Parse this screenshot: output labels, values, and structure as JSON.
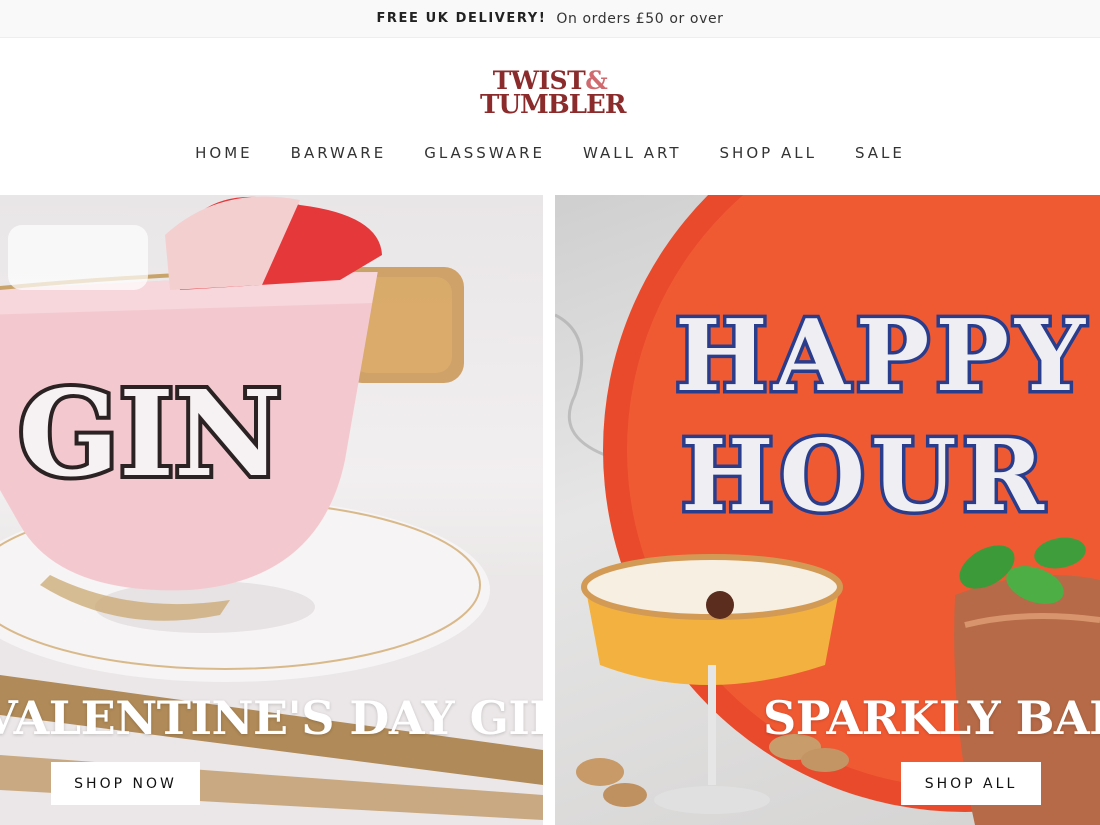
{
  "announcement": {
    "strong": "FREE UK DELIVERY!",
    "text": "On orders £50 or over"
  },
  "logo": {
    "line1_a": "TWIST",
    "line1_b": "&",
    "line2": "TUMBLER"
  },
  "nav": [
    "HOME",
    "BARWARE",
    "GLASSWARE",
    "WALL ART",
    "SHOP ALL",
    "SALE"
  ],
  "panels": [
    {
      "title": "VALENTINE'S DAY GIFTS",
      "button": "SHOP NOW",
      "cup_text": "GIN"
    },
    {
      "title": "SPARKLY BARWARE",
      "button": "SHOP ALL",
      "tray_line1": "HAPPY",
      "tray_line2": "HOUR"
    }
  ],
  "colors": {
    "logo_dark": "#8b2b2b",
    "logo_light": "#d06a6f",
    "tray": "#e84a2b",
    "cup": "#f3c9cf"
  }
}
